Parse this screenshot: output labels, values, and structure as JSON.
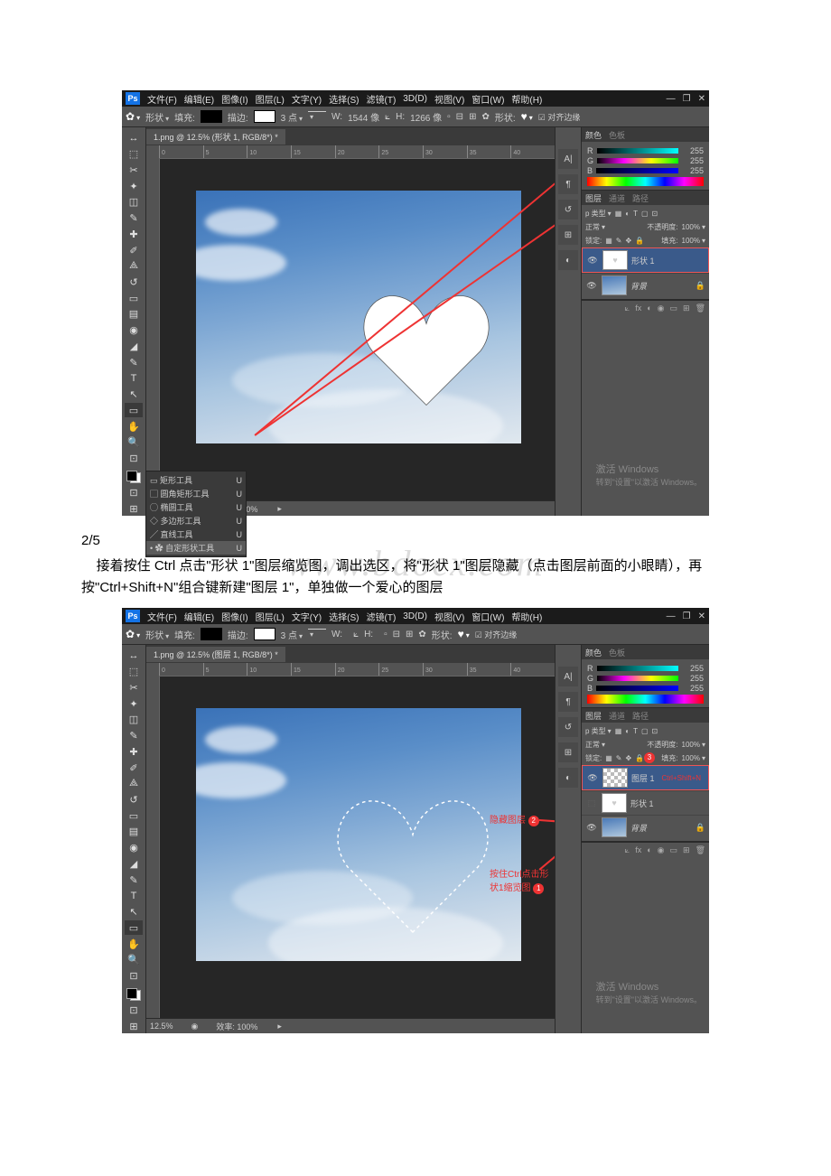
{
  "menu": {
    "file": "文件(F)",
    "edit": "编辑(E)",
    "image": "图像(I)",
    "layer": "图层(L)",
    "type": "文字(Y)",
    "select": "选择(S)",
    "filter": "滤镜(T)",
    "3d": "3D(D)",
    "view": "视图(V)",
    "window": "窗口(W)",
    "help": "帮助(H)"
  },
  "options": {
    "shape_mode": "形状",
    "fill_label": "填充:",
    "stroke_label": "描边:",
    "stroke_pt": "3 点",
    "w_label": "W:",
    "w_value": "1544 像",
    "h_label": "H:",
    "h_value": "1266 像",
    "shape_btn_label": "形状:",
    "align_edges": "对齐边缘"
  },
  "tabs": {
    "top": "1.png @ 12.5% (形状 1, RGB/8*) *",
    "bottom": "1.png @ 12.5% (图层 1, RGB/8*) *"
  },
  "ruler": [
    "0",
    "5",
    "10",
    "15",
    "20",
    "25",
    "30",
    "35",
    "40"
  ],
  "status": {
    "zoom": "12.5%",
    "eff": "效率: 100%"
  },
  "panels": {
    "color_tab": "颜色",
    "swatch_tab": "色板",
    "r": "R",
    "g": "G",
    "b": "B",
    "val": "255",
    "layers_tab": "图层",
    "channels_tab": "通道",
    "paths_tab": "路径",
    "kind_label": "p 类型",
    "blend": "正常",
    "opacity_label": "不透明度:",
    "opacity_val": "100%",
    "lock_label": "锁定:",
    "fill_label": "填充:",
    "fill_val": "100%",
    "layer_shape1": "形状 1",
    "layer_layer1": "图层 1",
    "layer_bg": "背景"
  },
  "flyout": {
    "rect": "矩形工具",
    "rrect": "圆角矩形工具",
    "ellipse": "椭圆工具",
    "poly": "多边形工具",
    "line": "直线工具",
    "custom": "自定形状工具",
    "key": "U"
  },
  "activate": {
    "title": "激活 Windows",
    "sub": "转到\"设置\"以激活 Windows。"
  },
  "annotations": {
    "hide_layer": "隐藏图层",
    "ctrl_click": "按住Ctrl点击形状1缩览图",
    "ctrl_shift": "Ctrl+Shift+N"
  },
  "watermark": "www.bdocx.com",
  "page_indicator": "2/5",
  "body_text": "接着按住 Ctrl 点击\"形状 1\"图层缩览图，调出选区，将\"形状 1\"图层隐藏（点击图层前面的小眼睛），再按\"Ctrl+Shift+N\"组合键新建\"图层 1\"，单独做一个爱心的图层"
}
